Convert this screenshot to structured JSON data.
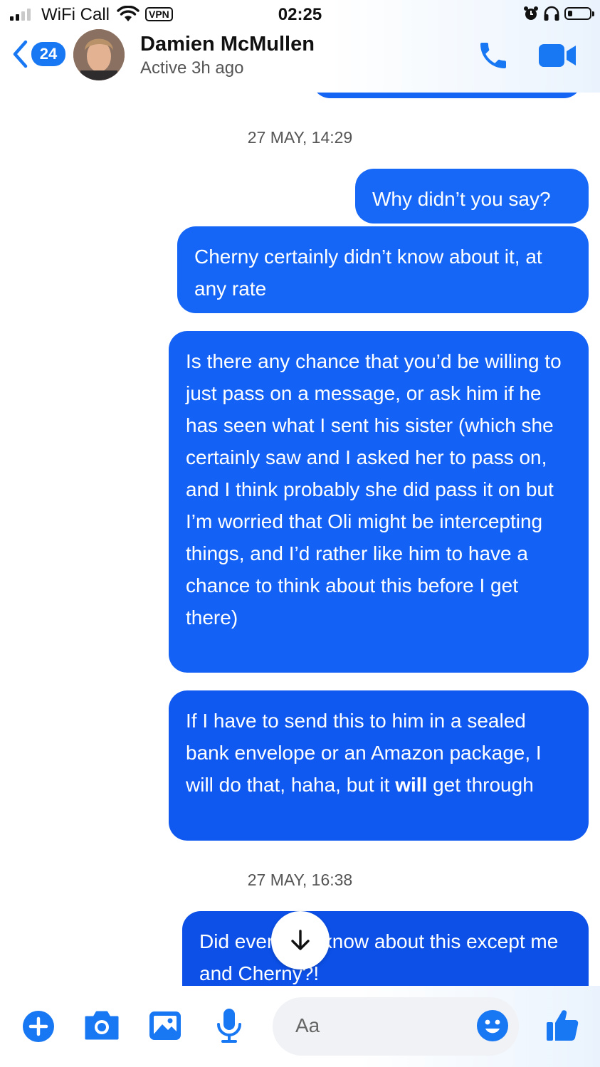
{
  "status_bar": {
    "carrier": "WiFi Call",
    "vpn": "VPN",
    "time": "02:25"
  },
  "header": {
    "back_count": "24",
    "contact_name": "Damien McMullen",
    "presence": "Active 3h ago"
  },
  "colors": {
    "accent": "#1877f2",
    "bubble": "#1466f6"
  },
  "messages": [
    {
      "type": "timestamp",
      "text": "27 MAY, 14:29"
    },
    {
      "type": "sent",
      "text": "Why didn’t you say?"
    },
    {
      "type": "sent",
      "text": "Cherny certainly didn’t know about it, at any rate"
    },
    {
      "type": "sent",
      "text": "Is there any chance that you’d be willing to just pass on a message, or ask him if he has seen what I sent his sister (which she certainly saw and I asked her to pass on, and I think probably she did pass it on but I’m worried that Oli might be intercepting things, and I’d rather like him to have a chance to think about this before I get there)"
    },
    {
      "type": "sent",
      "text_before": "If I have to send this to him in a sealed bank envelope or an Amazon package, I will do that, haha, but it ",
      "text_bold": "will",
      "text_after": " get through"
    },
    {
      "type": "timestamp",
      "text": "27 MAY, 16:38"
    },
    {
      "type": "sent",
      "text": "Did everyone know about this except me and Cherny?!"
    }
  ],
  "composer": {
    "placeholder": "Aa"
  },
  "icons": [
    "signal-icon",
    "wifi-icon",
    "alarm-icon",
    "headphones-icon",
    "battery-icon",
    "back-chevron-icon",
    "phone-icon",
    "video-icon",
    "down-arrow-icon",
    "plus-icon",
    "camera-icon",
    "image-icon",
    "microphone-icon",
    "emoji-icon",
    "thumbs-up-icon"
  ]
}
